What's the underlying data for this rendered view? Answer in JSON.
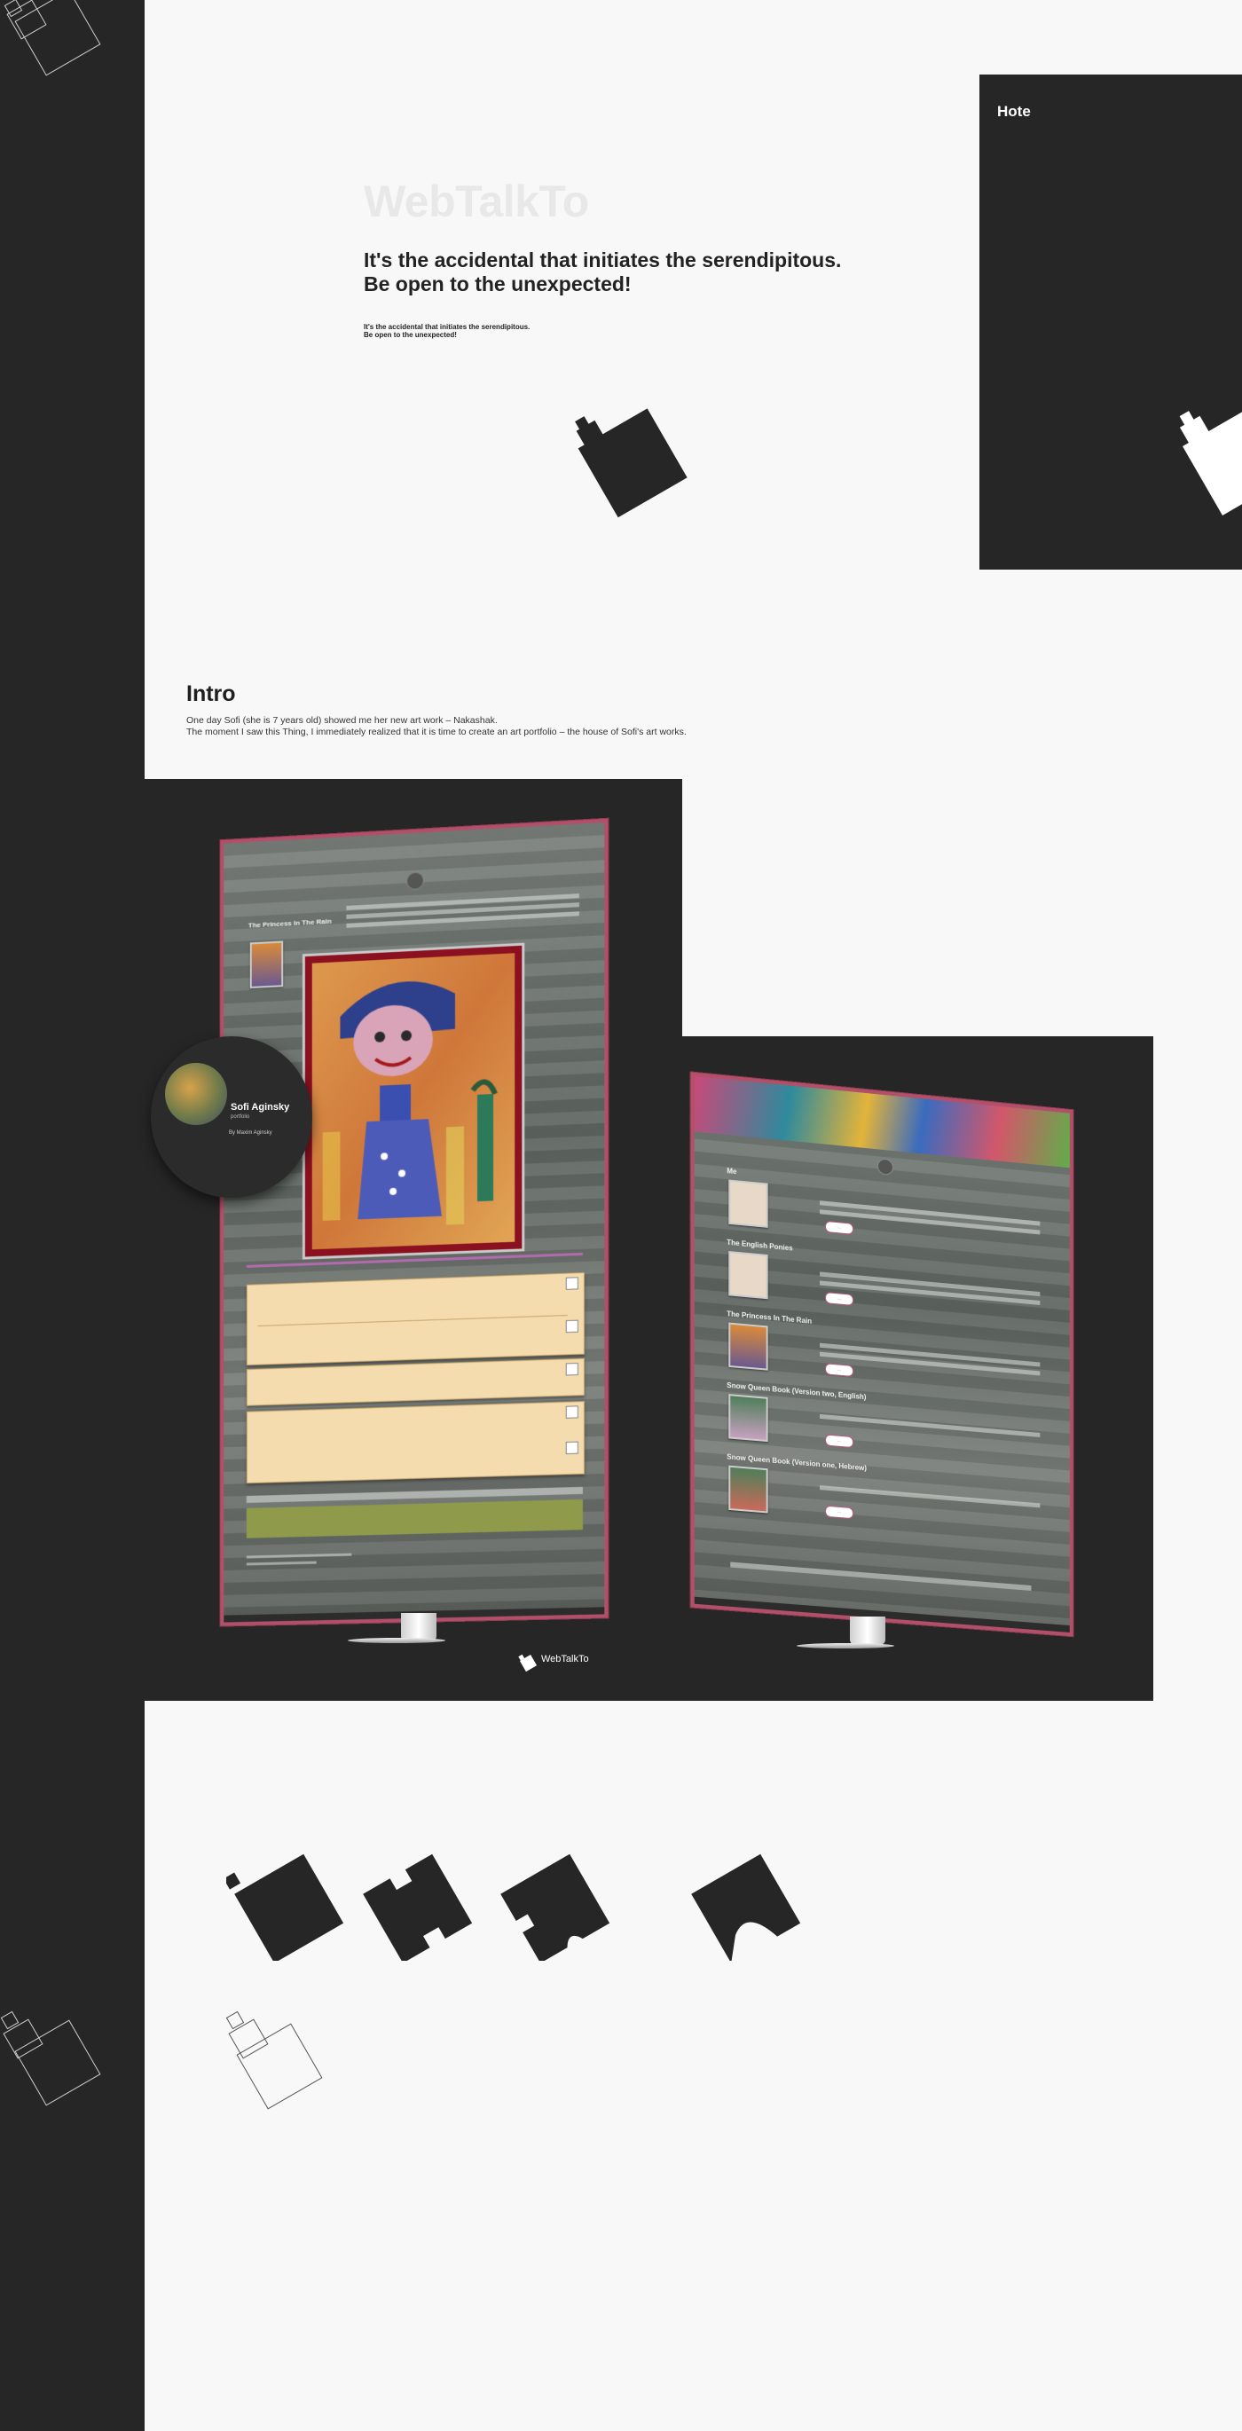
{
  "brand": {
    "name": "WebTalkTo",
    "tagline_line1": "It's the accidental that initiates the serendipitous.",
    "tagline_line2": "Be open to the unexpected!"
  },
  "side_panel": {
    "title": "Hote"
  },
  "intro": {
    "heading": "Intro",
    "line1": "One day Sofi (she is 7 years old) showed me her new art work – Nakashak.",
    "line2": "The moment I saw this Thing, I immediately realized that it is time to create an art portfolio – the house of Sofi's art works."
  },
  "profile": {
    "name": "Sofi Aginsky",
    "subtitle": "portfolio",
    "credit": "By Maxim Aginsky"
  },
  "left_screen": {
    "artwork_title": "The Princess In The Rain"
  },
  "right_screen": {
    "items": [
      {
        "title": "Me"
      },
      {
        "title": "The English Ponies"
      },
      {
        "title": "The Princess In The Rain"
      },
      {
        "title": "Snow Queen Book (Version two, English)"
      },
      {
        "title": "Snow Queen Book (Version one, Hebrew)"
      }
    ]
  },
  "footer": {
    "logo_text": "WebTalkTo"
  },
  "colors": {
    "dark": "#262626",
    "light": "#f8f8f8",
    "screen_border": "#b2506a",
    "comment_card": "#f4dcae"
  }
}
